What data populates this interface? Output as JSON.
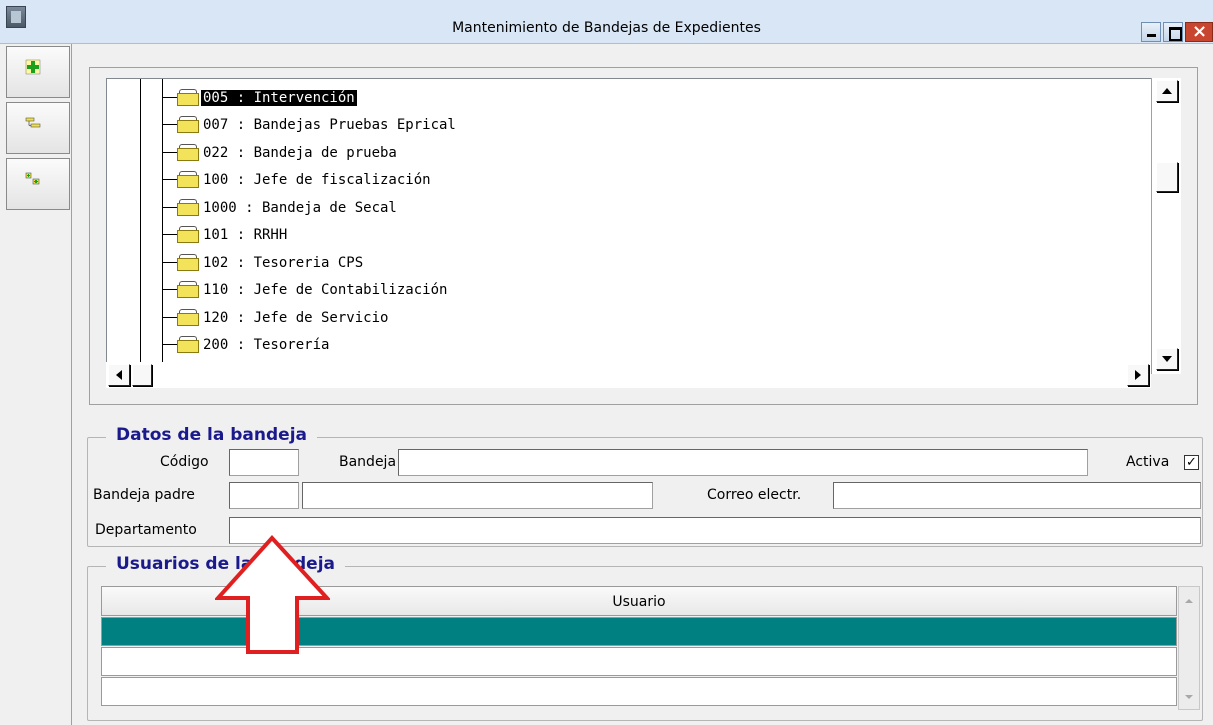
{
  "window": {
    "title": "Mantenimiento de Bandejas de Expedientes"
  },
  "toolbar": {
    "buttons": [
      {
        "icon": "add-green-plus-icon"
      },
      {
        "icon": "tree-collapse-icon"
      },
      {
        "icon": "tree-add-node-icon"
      }
    ]
  },
  "tree": {
    "items": [
      {
        "label": "005 : Intervención",
        "selected": true
      },
      {
        "label": "007 : Bandejas Pruebas Eprical",
        "selected": false
      },
      {
        "label": "022 : Bandeja de prueba",
        "selected": false
      },
      {
        "label": "100 : Jefe de fiscalización",
        "selected": false
      },
      {
        "label": "1000 : Bandeja de Secal",
        "selected": false
      },
      {
        "label": "101 : RRHH",
        "selected": false
      },
      {
        "label": "102 : Tesoreria CPS",
        "selected": false
      },
      {
        "label": "110 : Jefe de Contabilización",
        "selected": false
      },
      {
        "label": "120 : Jefe de Servicio",
        "selected": false
      },
      {
        "label": "200 : Tesorería",
        "selected": false
      }
    ]
  },
  "datos": {
    "legend": "Datos de la bandeja",
    "codigo_label": "Código",
    "codigo_value": "",
    "bandeja_label": "Bandeja",
    "bandeja_value": "",
    "activa_label": "Activa",
    "activa_checked": true,
    "activa_mark": "✓",
    "padre_label": "Bandeja padre",
    "padre_code": "",
    "padre_name": "",
    "correo_label": "Correo electr.",
    "correo_value": "",
    "departamento_label": "Departamento",
    "departamento_value": ""
  },
  "usuarios": {
    "legend": "Usuarios de la bandeja",
    "column": "Usuario",
    "rows": [
      "",
      "",
      ""
    ]
  },
  "colors": {
    "legend": "#1a1a8c",
    "selected_row": "#008080",
    "annotation_arrow": "#e02020"
  }
}
